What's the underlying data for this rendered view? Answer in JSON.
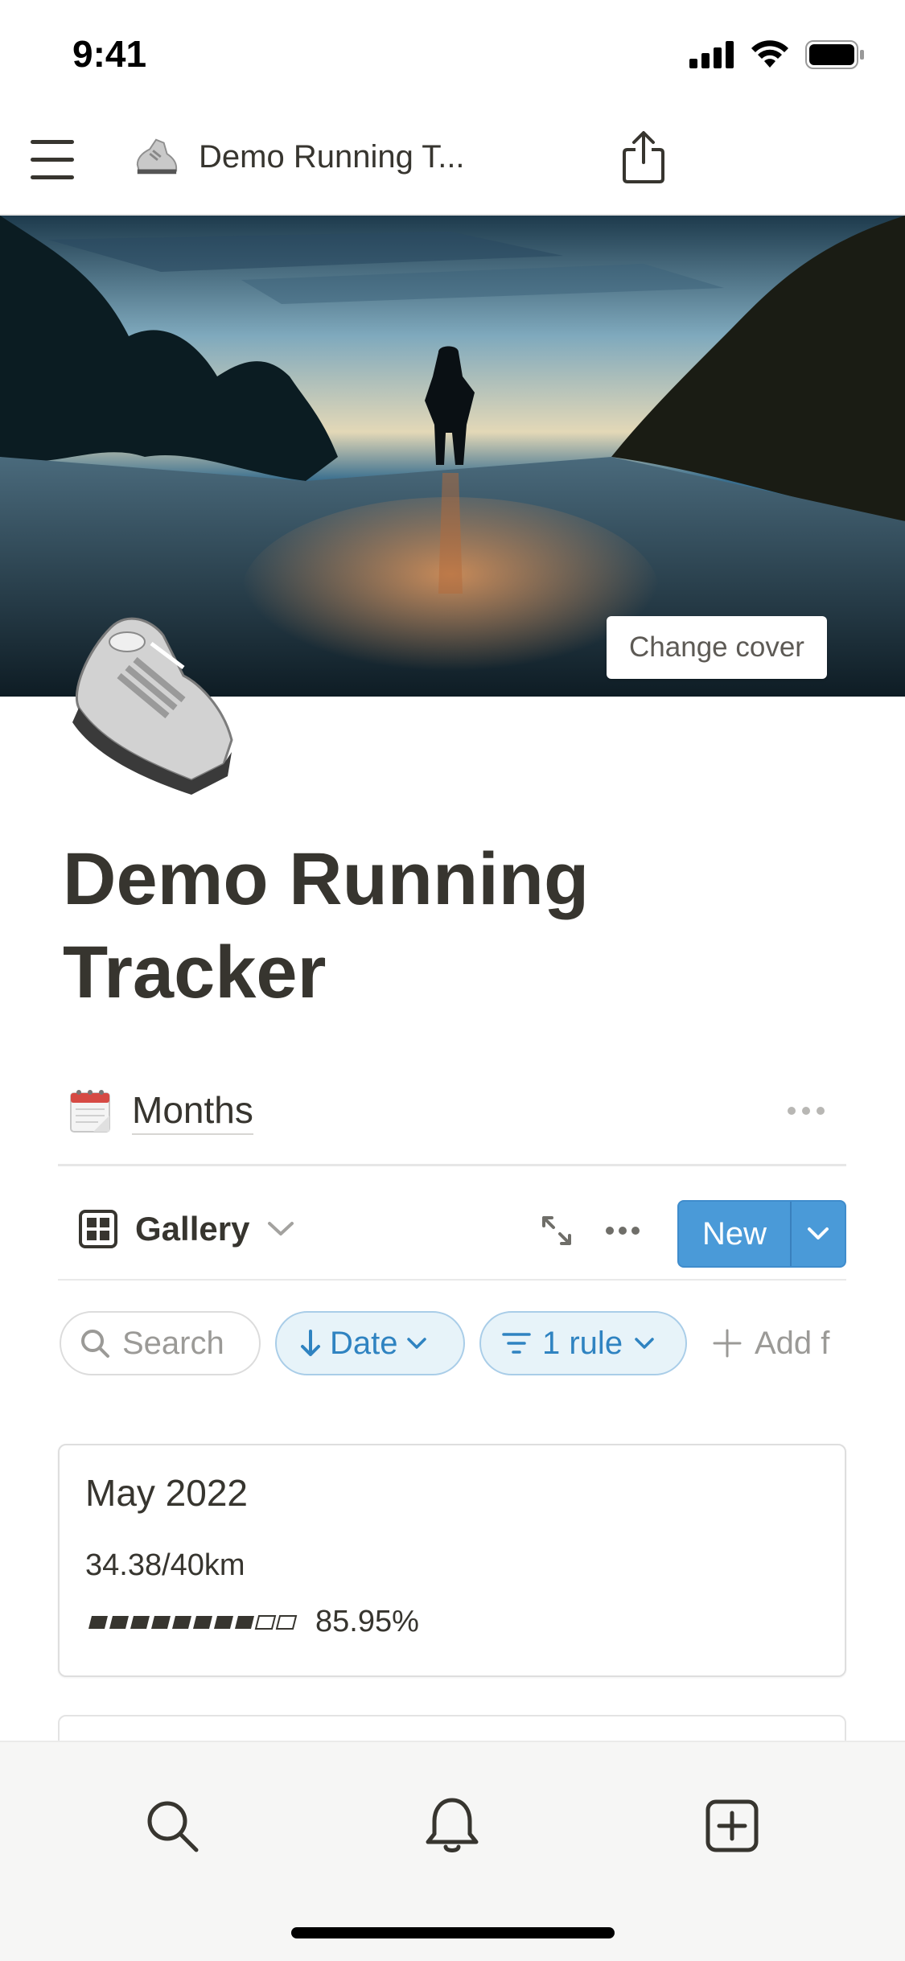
{
  "status_bar": {
    "time": "9:41"
  },
  "top_nav": {
    "page_emoji_icon": "running-shoe-icon",
    "title": "Demo Running T..."
  },
  "cover": {
    "change_cover_label": "Change cover"
  },
  "page": {
    "title": "Demo Running Tracker",
    "icon": "running-shoe-icon"
  },
  "database": {
    "icon": "calendar-icon",
    "title": "Months",
    "view": {
      "label": "Gallery",
      "icon": "gallery-icon"
    },
    "new_button_label": "New",
    "filters": {
      "search_label": "Search",
      "sort_label": "Date",
      "rule_label": "1 rule",
      "add_filter_label": "Add f"
    },
    "cards": [
      {
        "title": "May 2022",
        "distance": "34.38/40km",
        "progress_text": "85.95%",
        "progress_filled_blocks": 8,
        "progress_total_blocks": 10
      }
    ]
  },
  "tab_bar": {
    "items": [
      "search-icon",
      "bell-icon",
      "new-page-icon"
    ]
  },
  "colors": {
    "accent": "#4a9ad8",
    "chip_blue": "#2f83c1",
    "text": "#37352f"
  }
}
